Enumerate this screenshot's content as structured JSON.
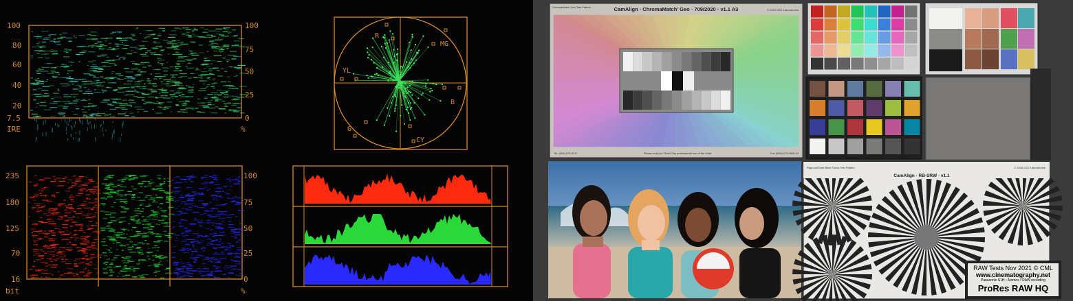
{
  "waveform": {
    "left_labels": [
      "100",
      "80",
      "60",
      "40",
      "20",
      "7.5"
    ],
    "right_labels": [
      "100",
      "75",
      "50",
      "25",
      "0"
    ],
    "left_unit": "IRE",
    "right_unit": "%"
  },
  "vectorscope": {
    "targets": [
      "R",
      "MG",
      "YL",
      "B",
      "G",
      "CY"
    ]
  },
  "parade": {
    "left_labels": [
      "235",
      "180",
      "125",
      "70",
      "16"
    ],
    "right_labels": [
      "100",
      "75",
      "50",
      "25",
      "0"
    ],
    "left_unit": "bit",
    "right_unit": "%"
  },
  "chart_geo": {
    "top_left": "ChromaMatch Geo Test Pattern",
    "title": "CamAlign · ChromaMatch' Geo · 709/2020 · v1.1 A3",
    "top_right": "© 2021 DSC Laboratories",
    "bottom_left": "Tel: (905) 673-3211",
    "bottom_center": "Please read pro Time/Chip professional use of the chart",
    "bottom_right": "Fax (905) 673-0929-44"
  },
  "chart_rbsrw": {
    "top_left": "RayLockChart Back Focus Test Pattern",
    "title": "CamAlign · RB-SRW · v1.1",
    "top_right": "© 2005 DSC Laboratories"
  },
  "slate": {
    "line1": "RAW Tests Nov 2021 © CML",
    "line2": "www.cinematography.net",
    "line3": "Panasonic S1H • Atomos • RAW recording",
    "line4": "ProRes RAW HQ"
  },
  "colors": {
    "scope_orange": "#d4892a",
    "trace_green": "#3cd86a",
    "trace_red": "#ff2a10",
    "trace_blue": "#2a2aff"
  }
}
